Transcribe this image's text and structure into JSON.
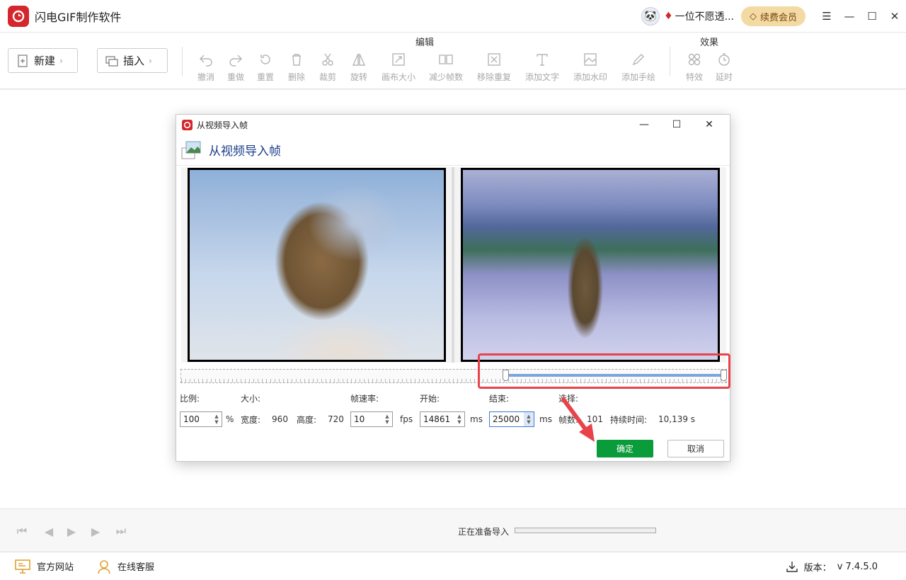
{
  "app": {
    "title": "闪电GIF制作软件",
    "username": "一位不愿透...",
    "vip_label": "续费会员",
    "brand_color": "#d4262c",
    "vip_color": "#f3d9a3"
  },
  "toolbar": {
    "new_label": "新建",
    "insert_label": "插入",
    "edit_group_label": "编辑",
    "effects_group_label": "效果",
    "edit_tools": [
      {
        "label": "撤消",
        "icon": "undo-icon"
      },
      {
        "label": "重做",
        "icon": "redo-icon"
      },
      {
        "label": "重置",
        "icon": "reset-icon"
      },
      {
        "label": "删除",
        "icon": "trash-icon"
      },
      {
        "label": "裁剪",
        "icon": "scissors-icon"
      },
      {
        "label": "旋转",
        "icon": "rotate-icon"
      },
      {
        "label": "画布大小",
        "icon": "canvas-size-icon"
      },
      {
        "label": "减少帧数",
        "icon": "reduce-frames-icon"
      },
      {
        "label": "移除重复",
        "icon": "remove-duplicate-icon"
      },
      {
        "label": "添加文字",
        "icon": "text-icon"
      },
      {
        "label": "添加水印",
        "icon": "watermark-icon"
      },
      {
        "label": "添加手绘",
        "icon": "pen-icon"
      }
    ],
    "effect_tools": [
      {
        "label": "特效",
        "icon": "effects-icon"
      },
      {
        "label": "延时",
        "icon": "timer-icon"
      }
    ]
  },
  "dialog": {
    "window_title": "从视频导入帧",
    "header_title": "从视频导入帧",
    "labels": {
      "scale": "比例:",
      "size": "大小:",
      "fps": "帧速率:",
      "start": "开始:",
      "end": "结束:",
      "selection": "选择:"
    },
    "values": {
      "scale": "100",
      "scale_unit": "%",
      "width_label": "宽度:",
      "width": "960",
      "height_label": "高度:",
      "height": "720",
      "fps": "10",
      "fps_unit": "fps",
      "start": "14861",
      "start_unit": "ms",
      "end": "25000",
      "end_unit": "ms",
      "frames_label": "帧数:",
      "frames": "101",
      "duration_label": "持续时间:",
      "duration": "10,139 s"
    },
    "ok_label": "确定",
    "cancel_label": "取消",
    "ok_color": "#0a9b3b",
    "highlight_color": "#e8434a"
  },
  "playback": {
    "status": "正在准备导入",
    "progress": 0
  },
  "footer": {
    "website_label": "官方网站",
    "support_label": "在线客服",
    "version_label": "版本：",
    "version": "v 7.4.5.0"
  }
}
